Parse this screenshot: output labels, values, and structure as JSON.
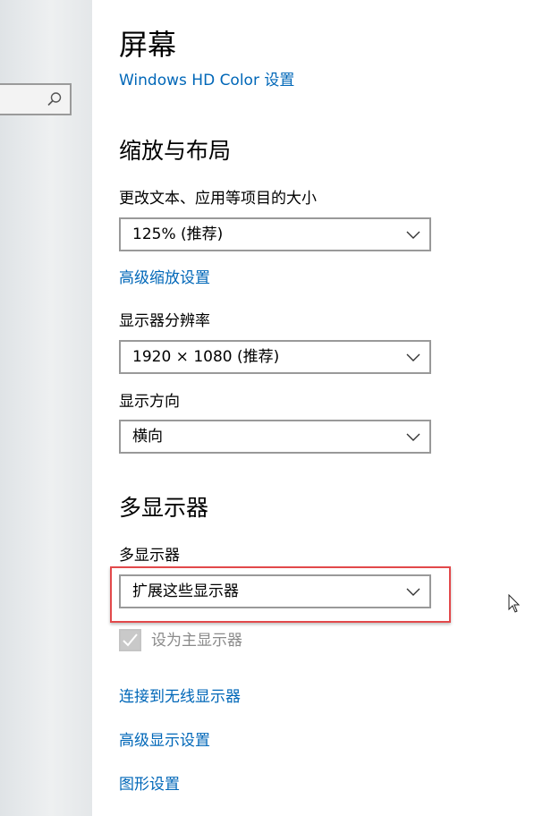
{
  "sidebar": {
    "search": {
      "placeholder": "",
      "icon": "search-icon"
    }
  },
  "main": {
    "page_title": "屏幕",
    "hdr_link": "Windows HD Color 设置",
    "scale_layout": {
      "heading": "缩放与布局",
      "text_size_label": "更改文本、应用等项目的大小",
      "text_size_value": "125% (推荐)",
      "advanced_scaling_link": "高级缩放设置",
      "resolution_label": "显示器分辨率",
      "resolution_value": "1920 × 1080 (推荐)",
      "orientation_label": "显示方向",
      "orientation_value": "横向"
    },
    "multiple_displays": {
      "heading": "多显示器",
      "label": "多显示器",
      "value": "扩展这些显示器",
      "make_main_label": "设为主显示器",
      "make_main_checked": true,
      "make_main_disabled": true
    },
    "links": {
      "connect_wireless": "连接到无线显示器",
      "advanced_display": "高级显示设置",
      "graphics": "图形设置"
    }
  },
  "colors": {
    "link": "#0067b8",
    "highlight": "#e2494b",
    "disabled_text": "#8a8a8a"
  }
}
